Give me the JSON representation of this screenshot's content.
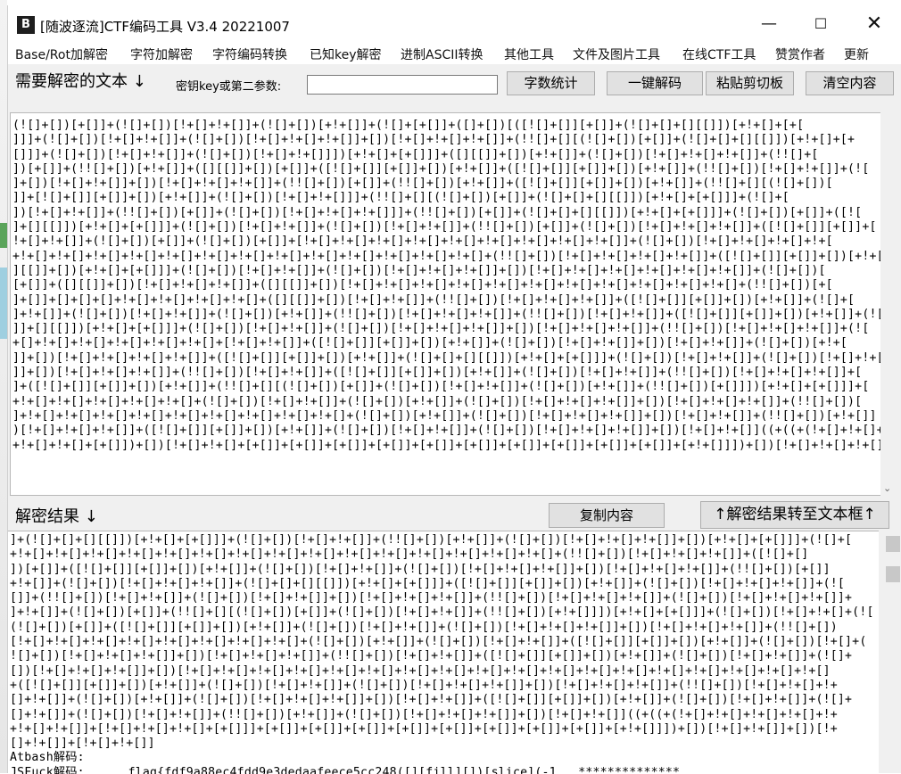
{
  "window": {
    "title": "[随波逐流]CTF编码工具 V3.4 20221007",
    "app_icon_glyph": "B",
    "controls": {
      "minimize": "—",
      "maximize": "☐",
      "close": "✕"
    }
  },
  "menu": [
    "Base/Rot加解密",
    "字符加解密",
    "字符编码转换",
    "已知key解密",
    "进制ASCII转换",
    "其他工具",
    "文件及图片工具",
    "在线CTF工具",
    "赞赏作者",
    "更新"
  ],
  "input_section": {
    "label": "需要解密的文本 ↓",
    "key_label": "密钥key或第二参数:",
    "key_value": "",
    "buttons": {
      "stats": "字数统计",
      "decode": "一键解码",
      "paste": "粘贴剪切板",
      "clear": "清空内容"
    },
    "text": "(![]+[])[+[]]+(![]+[])[!+[]+!+[]]+(![]+[])[+!+[]]+(![]+[+[]]+([]+[])[([![]+[]][+[]]+(![]+[]+[][[]])[+!+[]+[+[\n]]]+(![]+[])[!+[]+!+[]]+(![]+[])[!+[]+!+[]+!+[]]+[])[!+[]+!+[]+!+[]]+(!![]+[][(![]+[])[+[]]+(![]+[]+[][[]])[+!+[]+[+\n[]]]+(![]+[])[!+[]+!+[]]+(![]+[])[!+[]+!+[]]])[+!+[]+[+[]]]+([][[]]+[])[+!+[]]+(![]+[])[!+[]+!+[]+!+[]]+(!![]+[\n])[+[]]+(!![]+[])[+!+[]]+([][[]]+[])[+[]]+([![]+[]][+[]]+[])[+!+[]]+([![]+[]][+[]]+[])[+!+[]]+(!![]+[])[!+[]+!+[]]+(![\n]+[])[!+[]+!+[]]+[])[!+[]+!+[]+!+[]]+(!![]+[])[+[]]+(!![]+[])[+!+[]]+([![]+[]][+[]]+[])[+!+[]]+(!![]+[][(![]+[])[\n]]+[![]+[]][+[]]+[])[+!+[]]+(![]+[])[!+[]+!+[]]]+(!![]+[][(![]+[])[+[]]+(![]+[]+[][[]])[+!+[]+[+[]]]+(![]+[\n])[!+[]+!+[]]+(!![]+[])[+[]]+(![]+[])[!+[]+!+[]+!+[]]]+(!![]+[])[+[]]+(![]+[]+[][[]])[+!+[]+[+[]]]+(![]+[])[+[]]+([![\n]+[][[]])[+!+[]+[+[]]]+(![]+[])[!+[]+!+[]]+(![]+[])[!+[]+!+[]]+(!![]+[])[+[]]+(![]+[])[!+[]+!+[]+!+[]]+([![]+[]][+[]]+[\n!+[]+!+[]]+(![]+[])[+[]]+(![]+[])[+[]]+[!+[]+!+[]+!+[]+!+[]+!+[]+!+[]+!+[]+!+[]+!+[]]+(![]+[])[!+[]+!+[]+!+[]+!+[\n+!+[]+!+[]+!+[]+!+[]+!+[]+!+[]+!+[]+!+[]+!+[]+!+[]+!+[]+!+[]+!+[]+(!![]+[])[!+[]+!+[]+!+[]+!+[]]+([![]+[]][+[]]+[])[+!+[\n][[]]+[])[+!+[]+[+[]]]+(![]+[])[!+[]+!+[]]+(![]+[])[!+[]+!+[]+!+[]]+[])[!+[]+!+[]+!+[]+!+[]+!+[]+!+[]]+(![]+[])[\n[+[]]+([][[]]+[])[!+[]+!+[]+!+[]]+([][[]]+[])[!+[]+!+[]+!+[]+!+[]+!+[]+!+[]+!+[]+!+[]+!+[]+!+[]+!+[]+(!![]+[])[+[\n]+[]]+[]+[]+[]+!+[]+!+[]+!+[]+!+[]+([][[]]+[])[!+[]+!+[]]+(!![]+[])[!+[]+!+[]+!+[]]+([![]+[]][+[]]+[])[+!+[]]+(![]+[\n]+!+[]]+(![]+[])[!+[]+!+[]]+(![]+[])[+!+[]]+(!![]+[])[!+[]+!+[]+!+[]]+(!![]+[])[!+[]+!+[]]+([![]+[]][+[]]+[])[+!+[]]+(![\n]]+[][[]])[+!+[]+[+[]]]+(![]+[])[!+[]+!+[]]+(![]+[])[!+[]+!+[]+!+[]]+[])[!+[]+!+[]+!+[]]+(!![]+[])[!+[]+!+[]+!+[]]+(![\n+[]+!+[]+!+[]+!+[]+!+[]+!+[]+[!+[]+!+[]]+([![]+[]][+[]]+[])[+!+[]]+(![]+[])[!+[]+!+[]]+[])[!+[]+!+[]]+(![]+[])[+!+[\n]]+[])[!+[]+!+[]+!+[]+!+[]]+([![]+[]][+[]]+[])[+!+[]]+(![]+[]+[][[]])[+!+[]+[+[]]]+(![]+[])[!+[]+!+[]]+(![]+[])[!+[]+!+[\n]]+[])[!+[]+!+[]+!+[]]+(!![]+[])[!+[]+!+[]]+([![]+[]][+[]]+[])[+!+[]]+(![]+[])[!+[]+!+[]]+(!![]+[])[!+[]+!+[]+!+[]]+[\n]+([![]+[]][+[]]+[])[+!+[]]+(!![]+[][(![]+[])[+[]]+(![]+[])[!+[]+!+[]]+(![]+[])[+!+[]]+(!![]+[])[+[]]])[+!+[]+[+[]]]+[\n+!+[]+!+[]+!+[]+!+[]+!+[]+(![]+[])[!+[]+!+[]]+(![]+[])[+!+[]]+(![]+[])[!+[]+!+[]+!+[]]+[])[!+[]+!+[]+!+[]]+(!![]+[])[\n]+!+[]+!+[]+!+[]+!+[]+!+[]+!+[]+!+[]+!+[]+!+[]+(![]+[])[+!+[]]+(![]+[])[!+[]+!+[]+!+[]]+[])[!+[]+!+[]]+(!![]+[])[+!+[]]\n)[!+[]+!+[]+!+[]]+([![]+[]][+[]]+[])[+!+[]]+(![]+[])[!+[]+!+[]]+(![]+[])[!+[]+!+[]+!+[]]+[])[!+[]+!+[]]((+((+(!+[]+!+[]+!+[]+!+[]\n+!+[]+!+[]+[+[]])+[])[!+[]+!+[]+[+[]]+[+[]]+[+[]]+[+[]]+[+[]]+[+[]]+[+[]]+[+[]]+[+[]]+[+[]]+[+!+[]]])+[])[!+[]+!+[]+!+[]]"
  },
  "output_section": {
    "label": "解密结果 ↓",
    "buttons": {
      "copy": "复制内容",
      "transfer": "↑解密结果转至文本框↑"
    },
    "text": "]+(![]+[]+[][[]])[+!+[]+[+[]]]+(![]+[])[!+[]+!+[]]+(!![]+[])[+!+[]]+(![]+[])[!+[]+!+[]+!+[]]+[])[+!+[]+[+[]]]+(![]+[\n+!+[]+!+[]+!+[]+!+[]+!+[]+!+[]+!+[]+!+[]+!+[]+!+[]+!+[]+!+[]+!+[]+!+[]+!+[]+(!![]+[])[!+[]+!+[]+!+[]]+([![]+[]\n])[+[]]+([![]+[]][+[]]+[])[+!+[]]+(![]+[])[!+[]+!+[]]+(![]+[])[!+[]+!+[]+!+[]]+[])[!+[]+!+[]+!+[]]+(!![]+[])[+[]]\n+!+[]]+(![]+[])[!+[]+!+[]+!+[]]+(![]+[]+[][[]])[+!+[]+[+[]]]+([![]+[]][+[]]+[])[+!+[]]+(![]+[])[!+[]+!+[]+!+[]]+(![\n[]]+(!![]+[])[!+[]+!+[]]+(![]+[])[!+[]+!+[]]+[])[!+[]+!+[]+!+[]]+(!![]+[])[!+[]+!+[]+!+[]]+(![]+[])[!+[]+!+[]+!+[]]+\n]+!+[]]+(![]+[])[+[]]+(!![]+[][(![]+[])[+[]]+(![]+[])[!+[]+!+[]]+(!![]+[])[+!+[]]])[+!+[]+[+[]]]+(![]+[])[!+[]+!+[]+(![\n(![]+[])[+[]]+([![]+[]][+[]]+[])[+!+[]]+(![]+[])[!+[]+!+[]]+(![]+[])[!+[]+!+[]+!+[]]+[])[!+[]+!+[]+!+[]]+(!![]+[])\n[!+[]+!+[]+!+[]+!+[]+!+[]+!+[]+!+[]+!+[]+(![]+[])[+!+[]]+(![]+[])[!+[]+!+[]]+([![]+[]][+[]]+[])[+!+[]]+(![]+[])[!+[]+(\n![]+[])[!+[]+!+[]+!+[]]+[])[!+[]+!+[]+!+[]]+(!![]+[])[!+[]+!+[]]+([![]+[]][+[]]+[])[+!+[]]+(![]+[])[!+[]+!+[]]+(![]+\n[])[!+[]+!+[]+!+[]]+[])[!+[]+!+[]+!+[]+!+[]+!+[]+!+[]+!+[]+!+[]+!+[]+!+[]+!+[]+!+[]+!+[]+!+[]+!+[]+!+[]+!+[]+!+[]\n+([![]+[]][+[]]+[])[+!+[]]+(![]+[])[!+[]+!+[]]+(![]+[])[!+[]+!+[]+!+[]]+[])[!+[]+!+[]+!+[]]+(!![]+[])[!+[]+!+[]+!+\n[]+!+[]]+(![]+[])[+!+[]]+(![]+[])[!+[]+!+[]+!+[]]+[])[!+[]+!+[]]+([![]+[]][+[]]+[])[+!+[]]+(![]+[])[!+[]+!+[]]+(![]+\n[]+!+[]]+(![]+[])[!+[]+!+[]]+(!![]+[])[+!+[]]+(![]+[])[!+[]+!+[]+!+[]]+[])[!+[]+!+[]]((+((+(!+[]+!+[]+!+[]+!+[]+!+\n+!+[]+!+[]]+[!+[]+!+[]+!+[]+[+[]]]+[+[]]+[+[]]+[+[]]+[+[]]+[+[]]+[+[]]+[+[]]+[+[]]+[+!+[]]])+[])[!+[]+!+[]]+[])[!+\n[]+!+[]]+[!+[]+!+[]]\nAtbash解码:\nJSFuck解码:      flag{fdf9a88ec4fdd9e3dedaafeece5cc248([][fill][])[slice](-1   **************"
  }
}
